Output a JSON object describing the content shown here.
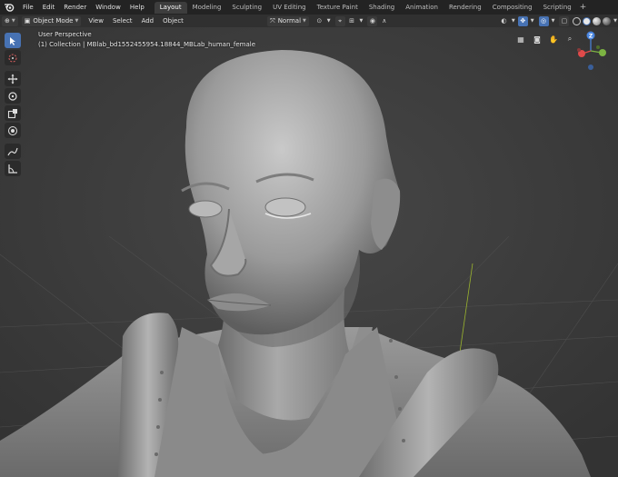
{
  "menu": {
    "items": [
      "File",
      "Edit",
      "Render",
      "Window",
      "Help"
    ]
  },
  "workspaces": {
    "tabs": [
      "Layout",
      "Modeling",
      "Sculpting",
      "UV Editing",
      "Texture Paint",
      "Shading",
      "Animation",
      "Rendering",
      "Compositing",
      "Scripting"
    ],
    "active": "Layout",
    "add_label": "+"
  },
  "header": {
    "mode": "Object Mode",
    "view": "View",
    "select": "Select",
    "add": "Add",
    "object": "Object",
    "orientation": "Normal"
  },
  "viewport": {
    "perspective_label": "User Perspective",
    "collection_label": "(1) Collection | MBlab_bd1552455954.18844_MBLab_human_female"
  },
  "gizmo": {
    "axis_z": "Z",
    "axis_colors": {
      "x": "#e04a4a",
      "y": "#7cb342",
      "z": "#4a86e0"
    }
  },
  "colors": {
    "accent": "#4772b3",
    "background": "#3d3d3d"
  },
  "icons": [
    "move-icon",
    "rotate-icon",
    "scale-icon",
    "transform-icon",
    "annotate-icon",
    "measure-icon",
    "cursor-icon",
    "select-box-icon"
  ]
}
